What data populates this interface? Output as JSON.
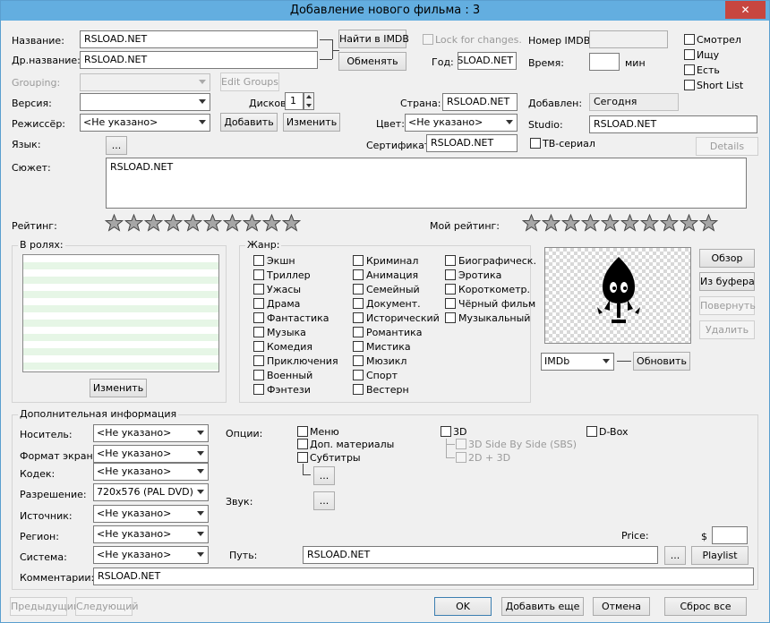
{
  "window": {
    "title": "Добавление нового фильма : 3",
    "close_glyph": "✕"
  },
  "fields": {
    "name_label": "Название:",
    "name_value": "RSLOAD.NET",
    "alt_name_label": "Др.название:",
    "alt_name_value": "RSLOAD.NET",
    "grouping_label": "Grouping:",
    "version_label": "Версия:",
    "discs_label": "Дисков:",
    "discs_value": "1",
    "director_label": "Режиссёр:",
    "director_value": "<Не указано>",
    "language_label": "Язык:",
    "language_button": "...",
    "plot_label": "Сюжет:",
    "plot_value": "RSLOAD.NET",
    "lock_label": "Lock for changes.",
    "year_label": "Год:",
    "year_value": "RSLOAD.NET",
    "imdb_number_label": "Номер IMDB:",
    "time_label": "Время:",
    "time_unit": "мин",
    "country_label": "Страна:",
    "country_value": "RSLOAD.NET",
    "added_label": "Добавлен:",
    "added_value": "Сегодня",
    "color_label": "Цвет:",
    "color_value": "<Не указано>",
    "studio_label": "Studio:",
    "studio_value": "RSLOAD.NET",
    "certificate_label": "Сертификат:",
    "certificate_value": "RSLOAD.NET",
    "tv_series_label": "ТВ-сериал"
  },
  "flags": {
    "watched": "Смотрел",
    "searching": "Ищу",
    "have": "Есть",
    "short_list": "Short List"
  },
  "buttons": {
    "find_imdb": "Найти в IMDB",
    "swap": "Обменять",
    "edit_groups": "Edit Groups",
    "add": "Добавить",
    "edit": "Изменить",
    "details": "Details",
    "cast_edit": "Изменить",
    "browse": "Обзор",
    "from_clipboard": "Из буфера",
    "rotate": "Повернуть",
    "delete": "Удалить",
    "update": "Обновить",
    "previous": "Предыдущий",
    "next": "Следующий",
    "ok": "OK",
    "add_more": "Добавить еще",
    "cancel": "Отмена",
    "reset_all": "Сброс все",
    "playlist": "Playlist",
    "path_browse": "...",
    "subtitles_more": "...",
    "sound_more": "..."
  },
  "rating": {
    "label": "Рейтинг:",
    "my_label": "Мой рейтинг:",
    "max_stars": 10,
    "value": 0,
    "my_value": 0
  },
  "cast": {
    "label": "В ролях:"
  },
  "genres": {
    "label": "Жанр:",
    "col1": [
      "Экшн",
      "Триллер",
      "Ужасы",
      "Драма",
      "Фантастика",
      "Музыка",
      "Комедия",
      "Приключения",
      "Военный",
      "Фэнтези"
    ],
    "col2": [
      "Криминал",
      "Анимация",
      "Семейный",
      "Документ.",
      "Исторический",
      "Романтика",
      "Мистика",
      "Мюзикл",
      "Спорт",
      "Вестерн"
    ],
    "col3": [
      "Биографическ.",
      "Эротика",
      "Короткометр.",
      "Чёрный фильм",
      "Музыкальный"
    ]
  },
  "poster": {
    "source_value": "IMDb"
  },
  "additional": {
    "label": "Дополнительная информация",
    "media_label": "Носитель:",
    "media_value": "<Не указано>",
    "screen_label": "Формат экрана:",
    "screen_value": "<Не указано>",
    "codec_label": "Кодек:",
    "codec_value": "<Не указано>",
    "resolution_label": "Разрешение:",
    "resolution_value": "720x576 (PAL DVD)",
    "source_label": "Источник:",
    "source_value": "<Не указано>",
    "region_label": "Регион:",
    "region_value": "<Не указано>",
    "system_label": "Система:",
    "system_value": "<Не указано>",
    "comments_label": "Комментарии:",
    "comments_value": "RSLOAD.NET",
    "options_label": "Опции:",
    "menu_label": "Меню",
    "extras_label": "Доп. материалы",
    "subtitles_label": "Субтитры",
    "sound_label": "Звук:",
    "threed_label": "3D",
    "sbs_label": "3D Side By Side (SBS)",
    "twod_label": "2D + 3D",
    "dbox_label": "D-Box",
    "price_label": "Price:",
    "currency": "$",
    "path_label": "Путь:",
    "path_value": "RSLOAD.NET"
  }
}
